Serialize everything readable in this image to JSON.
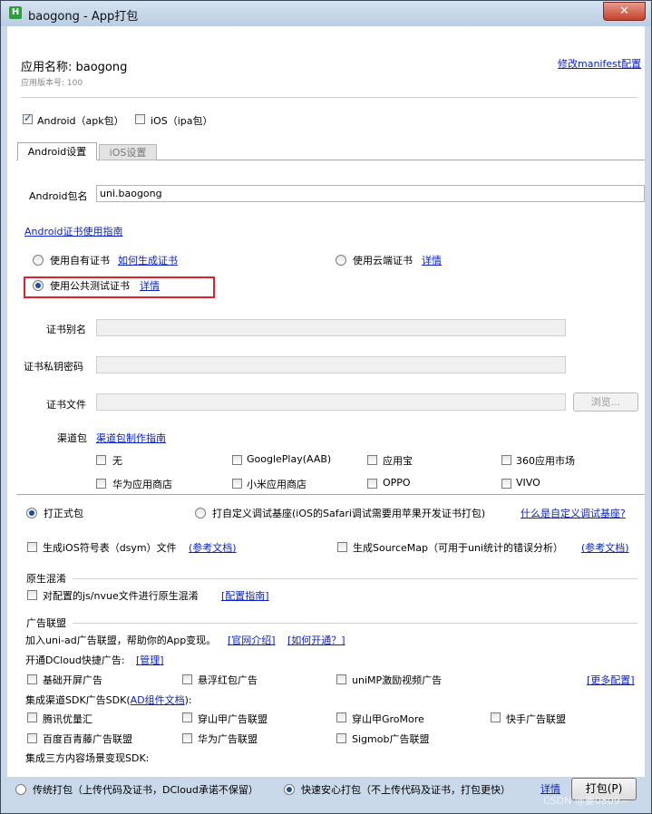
{
  "window": {
    "title": "baogong - App打包",
    "app_icon": "H",
    "close": "✕"
  },
  "header": {
    "app_name_label": "应用名称: baogong",
    "version_label": "应用版本号: 100",
    "manifest_link": "修改manifest配置"
  },
  "platforms": {
    "android_label": "Android（apk包）",
    "android_checked": true,
    "ios_label": "iOS（ipa包）",
    "ios_checked": false
  },
  "tabs": [
    {
      "label": "Android设置",
      "active": true
    },
    {
      "label": "iOS设置",
      "active": false
    }
  ],
  "android": {
    "package_label": "Android包名",
    "package_value": "uni.baogong",
    "cert_guide_link": "Android证书使用指南",
    "cert_own_label": "使用自有证书",
    "cert_own_link": "如何生成证书",
    "cert_cloud_label": "使用云端证书",
    "cert_cloud_link": "详情",
    "cert_public_label": "使用公共测试证书",
    "cert_public_link": "详情",
    "selected_cert": "public",
    "alias_label": "证书别名",
    "password_label": "证书私钥密码",
    "file_label": "证书文件",
    "browse_label": "浏览...",
    "channel_label": "渠道包",
    "channel_link": "渠道包制作指南",
    "channels": [
      {
        "label": "无",
        "checked": false
      },
      {
        "label": "GooglePlay(AAB)",
        "checked": false
      },
      {
        "label": "应用宝",
        "checked": false
      },
      {
        "label": "360应用市场",
        "checked": false
      },
      {
        "label": "华为应用商店",
        "checked": false
      },
      {
        "label": "小米应用商店",
        "checked": false
      },
      {
        "label": "OPPO",
        "checked": false
      },
      {
        "label": "VIVO",
        "checked": false
      }
    ]
  },
  "build_type": {
    "formal_label": "打正式包",
    "custom_label": "打自定义调试基座(iOS的Safari调试需要用苹果开发证书打包)",
    "custom_link": "什么是自定义调试基座?",
    "selected": "formal"
  },
  "symbols": {
    "dsym_label": "生成iOS符号表（dsym）文件",
    "dsym_link": "(参考文档)",
    "sourcemap_label": "生成SourceMap（可用于uni统计的错误分析）",
    "sourcemap_link": "(参考文档)"
  },
  "obfuscation": {
    "title": "原生混淆",
    "option_label": "对配置的js/nvue文件进行原生混淆",
    "option_link": "[配置指南]"
  },
  "ads": {
    "title": "广告联盟",
    "intro": "加入uni-ad广告联盟，帮助你的App变现。",
    "intro_link1": "[官网介绍]",
    "intro_link2": "[如何开通？]",
    "dcloud_label": "开通DCloud快捷广告:",
    "dcloud_link": "[管理]",
    "dcloud_items": [
      {
        "label": "基础开屏广告"
      },
      {
        "label": "悬浮红包广告"
      },
      {
        "label": "uniMP激励视频广告"
      }
    ],
    "more_link": "[更多配置]",
    "sdk_label_prefix": "集成渠道SDK广告SDK(",
    "sdk_label_link": "AD组件文档",
    "sdk_label_suffix": "):",
    "sdk_items": [
      {
        "label": "腾讯优量汇"
      },
      {
        "label": "穿山甲广告联盟"
      },
      {
        "label": "穿山甲GroMore"
      },
      {
        "label": "快手广告联盟"
      },
      {
        "label": "百度百青藤广告联盟"
      },
      {
        "label": "华为广告联盟"
      },
      {
        "label": "Sigmob广告联盟"
      }
    ],
    "third_party_label": "集成三方内容场景变现SDK:"
  },
  "footer": {
    "traditional_label": "传统打包（上传代码及证书，DCloud承诺不保留）",
    "fast_label": "快速安心打包（不上传代码及证书，打包更快）",
    "selected": "fast",
    "detail_link": "详情",
    "pack_button": "打包(P)",
    "watermark": "CSDN @要0809~"
  }
}
